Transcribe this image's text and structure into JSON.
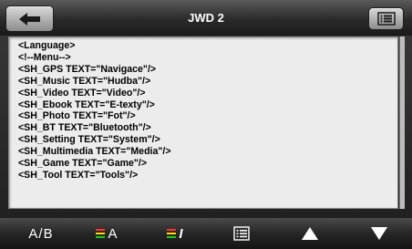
{
  "header": {
    "title": "JWD 2",
    "back_icon": "back-arrow-icon",
    "menu_icon": "list-menu-icon"
  },
  "editor": {
    "lines": [
      "<Language>",
      "<!--Menu-->",
      "<SH_GPS TEXT=\"Navigace\"/>",
      "<SH_Music TEXT=\"Hudba\"/>",
      "<SH_Video TEXT=\"Video\"/>",
      "<SH_Ebook TEXT=\"E-texty\"/>",
      "<SH_Photo TEXT=\"Fot\"/>",
      "<SH_BT TEXT=\"Bluetooth\"/>",
      "<SH_Setting TEXT=\"System\"/>",
      "<SH_Multimedia TEXT=\"Media\"/>",
      "<SH_Game TEXT=\"Game\"/>",
      "<SH_Tool TEXT=\"Tools\"/>"
    ]
  },
  "toolbar": {
    "ab_label": "A/B",
    "color_a_label": "A",
    "color_i_label": "I",
    "list_icon": "list-view-icon",
    "up_icon": "arrow-up-icon",
    "down_icon": "arrow-down-icon"
  },
  "colors": {
    "bar_red": "#ff3030",
    "bar_yellow": "#ffd800",
    "bar_green": "#22c422"
  }
}
